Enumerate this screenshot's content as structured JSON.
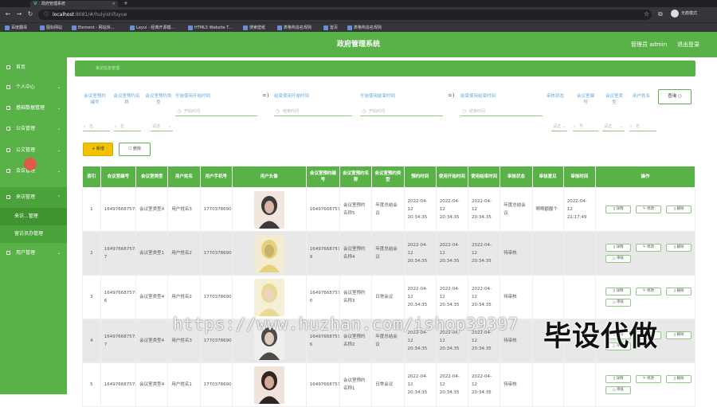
{
  "browser": {
    "tab_title": "政府管理系统",
    "tab_close": "×",
    "new_tab": "+",
    "url_host": "localhost",
    "url_path": ":8081/#/hulyishifuyue",
    "profile_label": "无痕模式",
    "bookmarks": [
      "百度翻译",
      "图标网站",
      "Element - 网站快...",
      "Layui - 经典开源模...",
      "HTML5 Website T...",
      "搜索壁纸",
      "表格构造名规则",
      "首页",
      "表格构造名规则"
    ]
  },
  "header": {
    "title": "政府管理系统",
    "user": "管理员 admin",
    "logout": "退出登录"
  },
  "sidebar": {
    "items": [
      {
        "label": "首页"
      },
      {
        "label": "个人中心"
      },
      {
        "label": "基础数据管理"
      },
      {
        "label": "公告管理"
      },
      {
        "label": "公文管理"
      },
      {
        "label": "会议管理"
      },
      {
        "label": "来访管理"
      },
      {
        "label": "用户管理"
      }
    ],
    "sub_items": [
      "来访...管理",
      "留访员办管理"
    ]
  },
  "breadcrumb": {
    "text": "来访信息管理"
  },
  "filters": {
    "labels_top": [
      "会议室预约编号",
      "会议室预约名称",
      "会议室预约类型",
      "开始使用开始时间",
      "结束使用开始时间",
      "开始使用结束时间",
      "结束使用结束时间",
      "审核状态",
      "会议室编号",
      "会议室类型",
      "用户姓名"
    ],
    "date_placeholders": [
      "开始时间",
      "结束时间",
      "开始时间",
      "结束时间"
    ],
    "arrow": "=)",
    "text_placeholders": [
      "名",
      "名"
    ],
    "select_placeholders": [
      "请选",
      "请选",
      "请选"
    ],
    "right_placeholders": [
      "号",
      "名"
    ],
    "search_label": "查询 ○"
  },
  "toolbar": {
    "add": "+ 新增",
    "delete": "☐ 删除"
  },
  "table": {
    "headers": [
      "索引",
      "会议室编号",
      "会议室类型",
      "用户姓名",
      "用户手机号",
      "用户头像",
      "会议室预约编号",
      "会议室预约名称",
      "会议室预约类型",
      "预约时间",
      "使用开始时间",
      "使用结束时间",
      "审核状态",
      "审核意见",
      "审核时间",
      "操作"
    ],
    "rows": [
      {
        "idx": "1",
        "room_no": "16497668757854",
        "room_type": "会议室类型4",
        "user": "用户姓名3",
        "phone": "17703786903",
        "booking_no": "16497668757902",
        "booking_name": "会议室预约名称5",
        "booking_type": "年度总结会议",
        "book_time": "2022-04-12 20:34:35",
        "start": "2022-04-12 20:34:35",
        "end": "2022-04-12 20:34:35",
        "status": "年度总结会议",
        "opinion": "啊啊额额个",
        "audit_time": "2022-04-12 21:17:49"
      },
      {
        "idx": "2",
        "room_no": "16497668757851 7",
        "room_type": "会议室类型1",
        "user": "用户姓名2",
        "phone": "17703786902",
        "booking_no": "16497668757901 9",
        "booking_name": "会议室预约名称4",
        "booking_type": "年度总结会议",
        "book_time": "2022-04-12 20:34:35",
        "start": "2022-04-12 20:34:35",
        "end": "2022-04-12 20:34:35",
        "status": "待审核",
        "opinion": "",
        "audit_time": ""
      },
      {
        "idx": "3",
        "room_no": "16497668757851 6",
        "room_type": "会议室类型4",
        "user": "用户姓名2",
        "phone": "17703786902",
        "booking_no": "16497668757901 0",
        "booking_name": "会议室预约名称3",
        "booking_type": "日常会议",
        "book_time": "2022-04-12 20:34:35",
        "start": "2022-04-12 20:34:35",
        "end": "2022-04-12 20:34:35",
        "status": "待审核",
        "opinion": "",
        "audit_time": ""
      },
      {
        "idx": "4",
        "room_no": "16497668757851 7",
        "room_type": "会议室类型4",
        "user": "用户姓名3",
        "phone": "17703786903",
        "booking_no": "16497668757901 6",
        "booking_name": "会议室预约名称2",
        "booking_type": "年度总结会议",
        "book_time": "2022-04-12 20:34:35",
        "start": "2022-04-12 20:34:35",
        "end": "2022-04-12 20:34:35",
        "status": "待审核",
        "opinion": "",
        "audit_time": ""
      },
      {
        "idx": "5",
        "room_no": "16497668757852",
        "room_type": "会议室类型4",
        "user": "用户姓名1",
        "phone": "17703786901",
        "booking_no": "16497668757901",
        "booking_name": "会议室预约名称1",
        "booking_type": "日常会议",
        "book_time": "2022-04-12 20:34:35",
        "start": "2022-04-12 20:34:35",
        "end": "2022-04-12 20:34:35",
        "status": "待审核",
        "opinion": "",
        "audit_time": ""
      }
    ],
    "actions": {
      "detail": "▯ 详情",
      "edit": "✎ 修改",
      "delete": "▯ 删除",
      "audit": "△ 审核"
    }
  },
  "overlay": {
    "watermark": "https://www.huzhan.com/ishop39397",
    "stamp": "毕设代做"
  },
  "colors": {
    "primary": "#59b247",
    "accent_yellow": "#f2c200",
    "label_blue": "#6aa9d8"
  }
}
